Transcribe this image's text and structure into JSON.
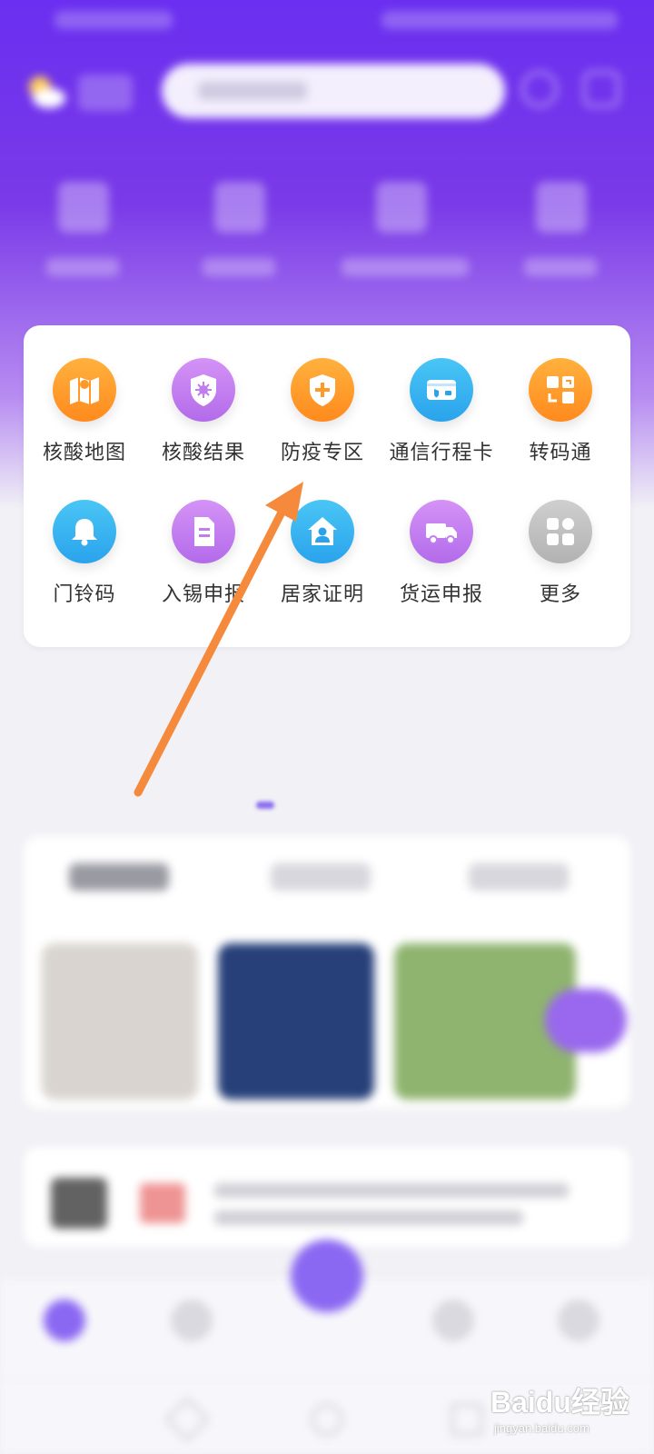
{
  "services": [
    {
      "label": "核酸地图",
      "icon": "map-icon",
      "color": "orange"
    },
    {
      "label": "核酸结果",
      "icon": "virus-shield-icon",
      "color": "violet"
    },
    {
      "label": "防疫专区",
      "icon": "plus-shield-icon",
      "color": "orange"
    },
    {
      "label": "通信行程卡",
      "icon": "travel-card-icon",
      "color": "blue"
    },
    {
      "label": "转码通",
      "icon": "code-convert-icon",
      "color": "orange"
    },
    {
      "label": "门铃码",
      "icon": "bell-icon",
      "color": "blue"
    },
    {
      "label": "入锡申报",
      "icon": "document-icon",
      "color": "violet"
    },
    {
      "label": "居家证明",
      "icon": "home-person-icon",
      "color": "blue"
    },
    {
      "label": "货运申报",
      "icon": "truck-icon",
      "color": "violet"
    },
    {
      "label": "更多",
      "icon": "grid-more-icon",
      "color": "gray"
    }
  ],
  "colors": {
    "header_purple": "#6a2ff0",
    "annotation_arrow": "#f58a3c",
    "accent_violet": "#8b68f2"
  },
  "watermark": {
    "brand": "Baidu经验",
    "url": "jingyan.baidu.com"
  }
}
